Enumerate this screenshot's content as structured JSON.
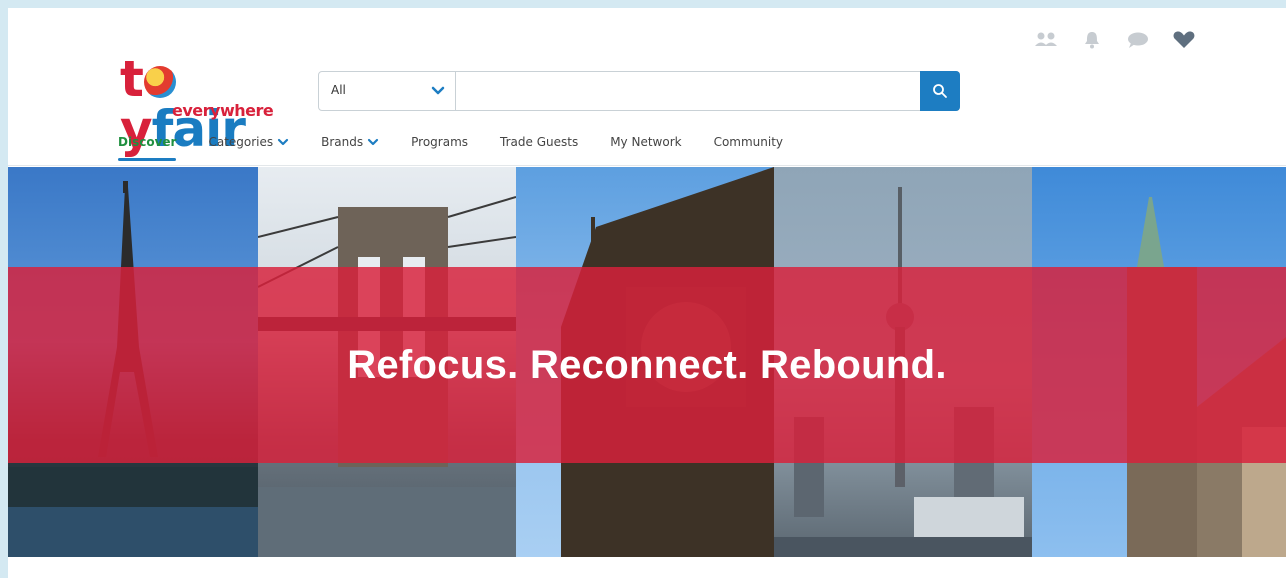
{
  "logo": {
    "main_prefix": "t",
    "main_middle": "y",
    "main_suffix": "fair",
    "sub": "everywhere"
  },
  "search": {
    "category_label": "All",
    "placeholder": ""
  },
  "util_icons": [
    "users-icon",
    "bell-icon",
    "chat-icon",
    "heart-icon"
  ],
  "nav": {
    "items": [
      {
        "label": "Discover",
        "active": true,
        "dropdown": false
      },
      {
        "label": "Categories",
        "active": false,
        "dropdown": true
      },
      {
        "label": "Brands",
        "active": false,
        "dropdown": true
      },
      {
        "label": "Programs",
        "active": false,
        "dropdown": false
      },
      {
        "label": "Trade Guests",
        "active": false,
        "dropdown": false
      },
      {
        "label": "My Network",
        "active": false,
        "dropdown": false
      },
      {
        "label": "Community",
        "active": false,
        "dropdown": false
      }
    ]
  },
  "hero": {
    "title": "Refocus. Reconnect. Rebound."
  },
  "colors": {
    "brand_red": "#d8213b",
    "brand_blue": "#1d7dc2",
    "active_green": "#1f8f3f"
  }
}
